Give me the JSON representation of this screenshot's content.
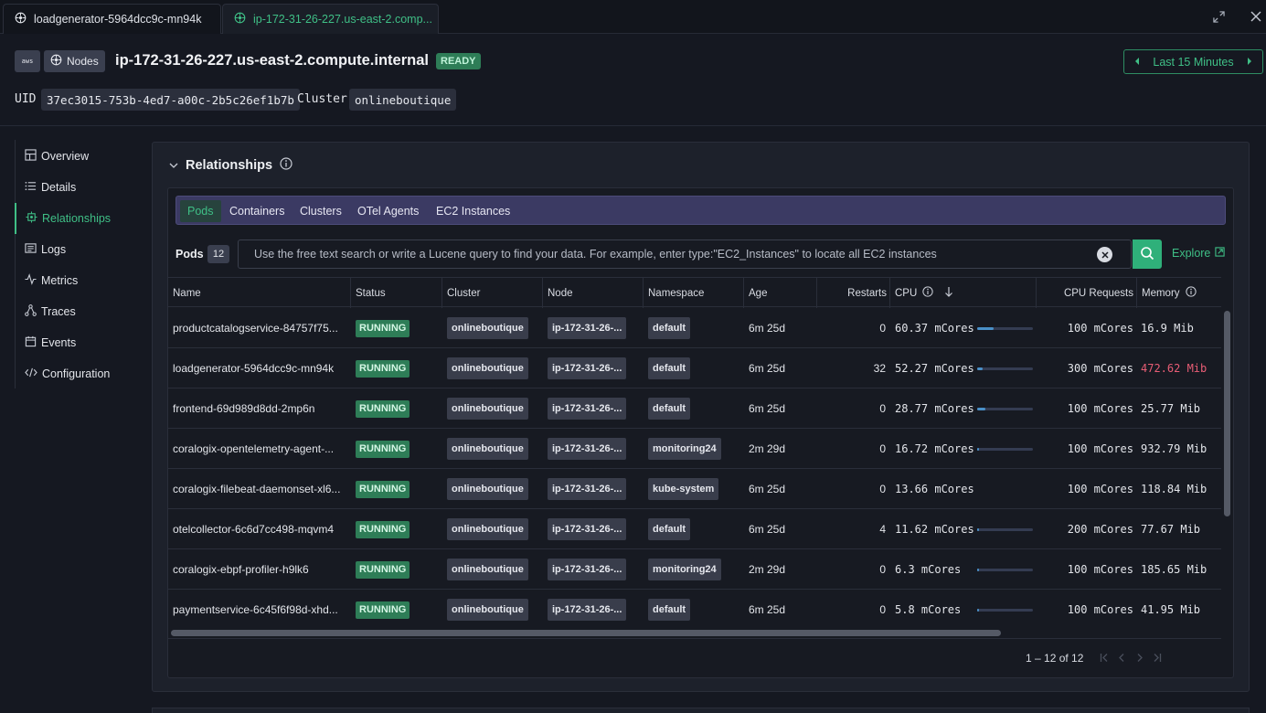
{
  "tabs": [
    {
      "label": "loadgenerator-5964dcc9c-mn94k",
      "icon": "kubernetes-icon"
    },
    {
      "label": "ip-172-31-26-227.us-east-2.comp...",
      "icon": "kubernetes-icon"
    }
  ],
  "header": {
    "aws_label": "aws",
    "nodes_label": "Nodes",
    "title": "ip-172-31-26-227.us-east-2.compute.internal",
    "status": "READY",
    "time_range": "Last 15 Minutes",
    "uid_label": "UID",
    "uid_value": "37ec3015-753b-4ed7-a00c-2b5c26ef1b7b",
    "cluster_label": "Cluster",
    "cluster_value": "onlineboutique"
  },
  "sidebar": {
    "items": [
      {
        "label": "Overview",
        "icon": "overview-icon"
      },
      {
        "label": "Details",
        "icon": "list-icon"
      },
      {
        "label": "Relationships",
        "icon": "relationships-icon"
      },
      {
        "label": "Logs",
        "icon": "logs-icon"
      },
      {
        "label": "Metrics",
        "icon": "metrics-icon"
      },
      {
        "label": "Traces",
        "icon": "traces-icon"
      },
      {
        "label": "Events",
        "icon": "calendar-icon"
      },
      {
        "label": "Configuration",
        "icon": "code-icon"
      }
    ],
    "active": "Relationships"
  },
  "relationships": {
    "title": "Relationships",
    "subtabs": [
      "Pods",
      "Containers",
      "Clusters",
      "OTel Agents",
      "EC2 Instances"
    ],
    "pods_label": "Pods",
    "pods_count": "12",
    "search_placeholder": "Use the free text search or write a Lucene query to find your data. For example, enter type:\"EC2_Instances\" to locate all EC2 instances",
    "explore_label": "Explore",
    "columns": [
      "Name",
      "Status",
      "Cluster",
      "Node",
      "Namespace",
      "Age",
      "Restarts",
      "CPU",
      "CPU Requests",
      "Memory"
    ],
    "rows": [
      {
        "name": "productcatalogservice-84757f75...",
        "status": "RUNNING",
        "cluster": "onlineboutique",
        "node": "ip-172-31-26-...",
        "namespace": "default",
        "age": "6m 25d",
        "restarts": "0",
        "cpu": "60.37 mCores",
        "cpu_fraction": 0.3,
        "cpu_requests": "100 mCores",
        "memory": "16.9 Mib",
        "memory_alert": false
      },
      {
        "name": "loadgenerator-5964dcc9c-mn94k",
        "status": "RUNNING",
        "cluster": "onlineboutique",
        "node": "ip-172-31-26-...",
        "namespace": "default",
        "age": "6m 25d",
        "restarts": "32",
        "cpu": "52.27 mCores",
        "cpu_fraction": 0.1,
        "cpu_requests": "300 mCores",
        "memory": "472.62 Mib",
        "memory_alert": true
      },
      {
        "name": "frontend-69d989d8dd-2mp6n",
        "status": "RUNNING",
        "cluster": "onlineboutique",
        "node": "ip-172-31-26-...",
        "namespace": "default",
        "age": "6m 25d",
        "restarts": "0",
        "cpu": "28.77 mCores",
        "cpu_fraction": 0.14,
        "cpu_requests": "100 mCores",
        "memory": "25.77 Mib",
        "memory_alert": false
      },
      {
        "name": "coralogix-opentelemetry-agent-...",
        "status": "RUNNING",
        "cluster": "onlineboutique",
        "node": "ip-172-31-26-...",
        "namespace": "monitoring24",
        "age": "2m 29d",
        "restarts": "0",
        "cpu": "16.72 mCores",
        "cpu_fraction": 0.03,
        "cpu_requests": "100 mCores",
        "memory": "932.79 Mib",
        "memory_alert": false
      },
      {
        "name": "coralogix-filebeat-daemonset-xl6...",
        "status": "RUNNING",
        "cluster": "onlineboutique",
        "node": "ip-172-31-26-...",
        "namespace": "kube-system",
        "age": "6m 25d",
        "restarts": "0",
        "cpu": "13.66 mCores",
        "cpu_fraction": null,
        "cpu_requests": "100 mCores",
        "memory": "118.84 Mib",
        "memory_alert": false
      },
      {
        "name": "otelcollector-6c6d7cc498-mqvm4",
        "status": "RUNNING",
        "cluster": "onlineboutique",
        "node": "ip-172-31-26-...",
        "namespace": "default",
        "age": "6m 25d",
        "restarts": "4",
        "cpu": "11.62 mCores",
        "cpu_fraction": 0.03,
        "cpu_requests": "200 mCores",
        "memory": "77.67 Mib",
        "memory_alert": false
      },
      {
        "name": "coralogix-ebpf-profiler-h9lk6",
        "status": "RUNNING",
        "cluster": "onlineboutique",
        "node": "ip-172-31-26-...",
        "namespace": "monitoring24",
        "age": "2m 29d",
        "restarts": "0",
        "cpu": "6.3 mCores",
        "cpu_fraction": 0.02,
        "cpu_requests": "100 mCores",
        "memory": "185.65 Mib",
        "memory_alert": false
      },
      {
        "name": "paymentservice-6c45f6f98d-xhd...",
        "status": "RUNNING",
        "cluster": "onlineboutique",
        "node": "ip-172-31-26-...",
        "namespace": "default",
        "age": "6m 25d",
        "restarts": "0",
        "cpu": "5.8 mCores",
        "cpu_fraction": 0.02,
        "cpu_requests": "100 mCores",
        "memory": "41.95 Mib",
        "memory_alert": false
      }
    ],
    "pagination": "1 – 12 of 12"
  },
  "colors": {
    "accent": "#3fbf86",
    "status_running": "#2e7d57",
    "alert": "#e85d75",
    "bar": "#4a90c8"
  }
}
